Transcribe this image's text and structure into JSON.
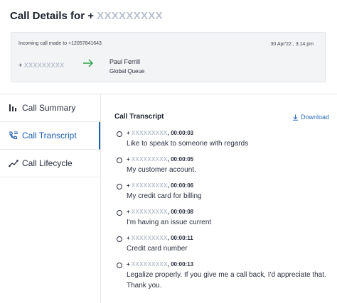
{
  "header": {
    "title_prefix": "Call Details for",
    "plus": "+",
    "masked_number": "XXXXXXXXX"
  },
  "call": {
    "made_to": "Incoming call made to +12057841643",
    "datetime": "30 Apr'22 , 3:14 pm",
    "caller_plus": "+",
    "caller_masked": "XXXXXXXXX",
    "arrow_color": "#2ea44f",
    "agent_name": "Paul Ferrill",
    "agent_queue": "Global Queue"
  },
  "sidebar": {
    "active_color": "#1c5fb0",
    "tabs": [
      {
        "label": "Call Summary",
        "icon": "bar-chart-icon"
      },
      {
        "label": "Call Transcript",
        "icon": "phone-transcript-icon"
      },
      {
        "label": "Call Lifecycle",
        "icon": "lifecycle-icon"
      }
    ]
  },
  "transcript": {
    "title": "Call Transcript",
    "download_label": "Download",
    "entries": [
      {
        "plus": "+",
        "masked": "XXXXXXXXX",
        "time": ", 00:00:03",
        "text": "Like to speak to someone with regards"
      },
      {
        "plus": "+",
        "masked": "XXXXXXXXX",
        "time": ", 00:00:05",
        "text": "My customer account."
      },
      {
        "plus": "+",
        "masked": "XXXXXXXXX",
        "time": ", 00:00:06",
        "text": "My credit card for billing"
      },
      {
        "plus": "+",
        "masked": "XXXXXXXXX",
        "time": ", 00:00:08",
        "text": "I'm having an issue current"
      },
      {
        "plus": "+",
        "masked": "XXXXXXXXX",
        "time": ", 00:00:11",
        "text": "Credit card number"
      },
      {
        "plus": "+",
        "masked": "XXXXXXXXX",
        "time": ", 00:00:13",
        "text": "Legalize properly. If you give me a call back, I'd appreciate that. Thank you."
      }
    ]
  }
}
